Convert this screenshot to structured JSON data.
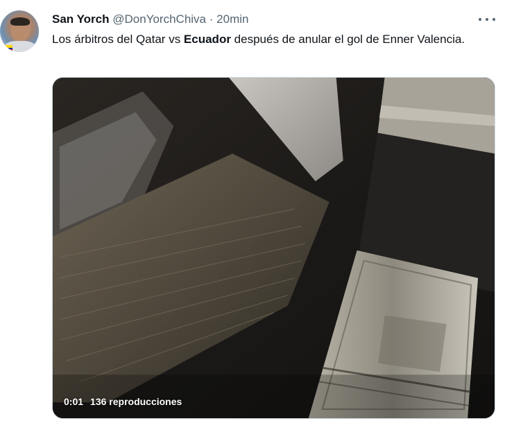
{
  "tweet": {
    "display_name": "San Yorch",
    "handle": "@DonYorchChiva",
    "separator": "·",
    "time": "20min",
    "text_before": "Los árbitros del Qatar vs ",
    "text_bold": "Ecuador",
    "text_after": " después de anular el gol de Enner Valencia."
  },
  "video": {
    "timestamp": "0:01",
    "views": "136 reproducciones"
  },
  "icons": {
    "more": "more-horizontal-icon",
    "avatar": "profile-avatar"
  }
}
